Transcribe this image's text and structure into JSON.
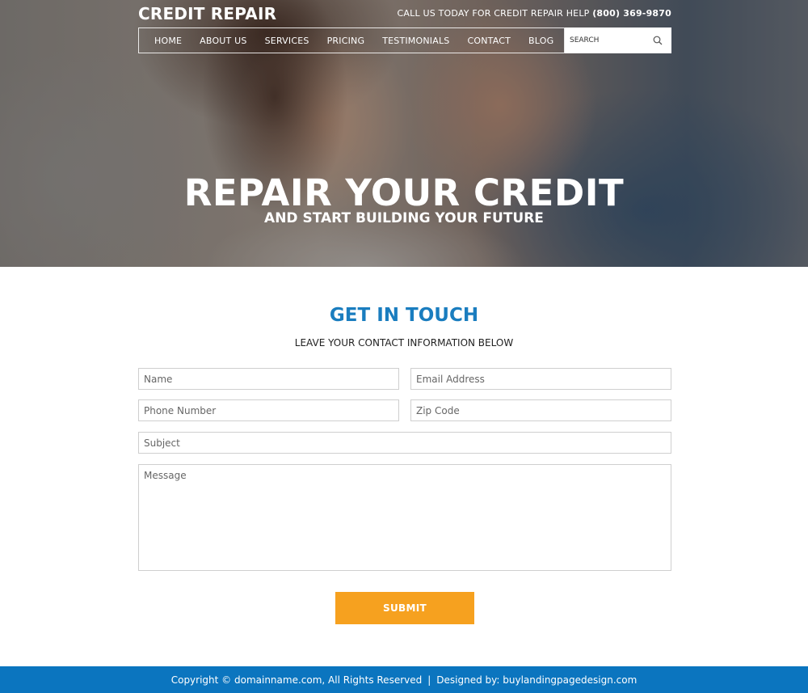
{
  "header": {
    "brand": "CREDIT REPAIR",
    "callus_text": "CALL US TODAY FOR CREDIT REPAIR HELP",
    "callus_phone": "(800) 369-9870"
  },
  "nav": {
    "items": [
      {
        "label": "HOME"
      },
      {
        "label": "ABOUT US"
      },
      {
        "label": "SERVICES"
      },
      {
        "label": "PRICING"
      },
      {
        "label": "TESTIMONIALS"
      },
      {
        "label": "CONTACT"
      },
      {
        "label": "BLOG"
      }
    ],
    "search_placeholder": "SEARCH",
    "search_icon": "search-icon"
  },
  "hero": {
    "title": "REPAIR YOUR CREDIT",
    "subtitle": "AND START BUILDING YOUR FUTURE"
  },
  "contact": {
    "title": "GET IN TOUCH",
    "subtitle": "LEAVE YOUR CONTACT INFORMATION BELOW",
    "fields": {
      "name": "Name",
      "email": "Email Address",
      "phone": "Phone Number",
      "zip": "Zip Code",
      "subject": "Subject",
      "message": "Message"
    },
    "submit_label": "SUBMIT"
  },
  "footer": {
    "copyright": "Copyright © domainname.com, All Rights Reserved",
    "separator": "|",
    "designed_by": "Designed by: buylandingpagedesign.com"
  },
  "colors": {
    "accent_blue": "#1a7dbf",
    "footer_blue": "#0b75bf",
    "button_orange": "#f6a11f"
  }
}
